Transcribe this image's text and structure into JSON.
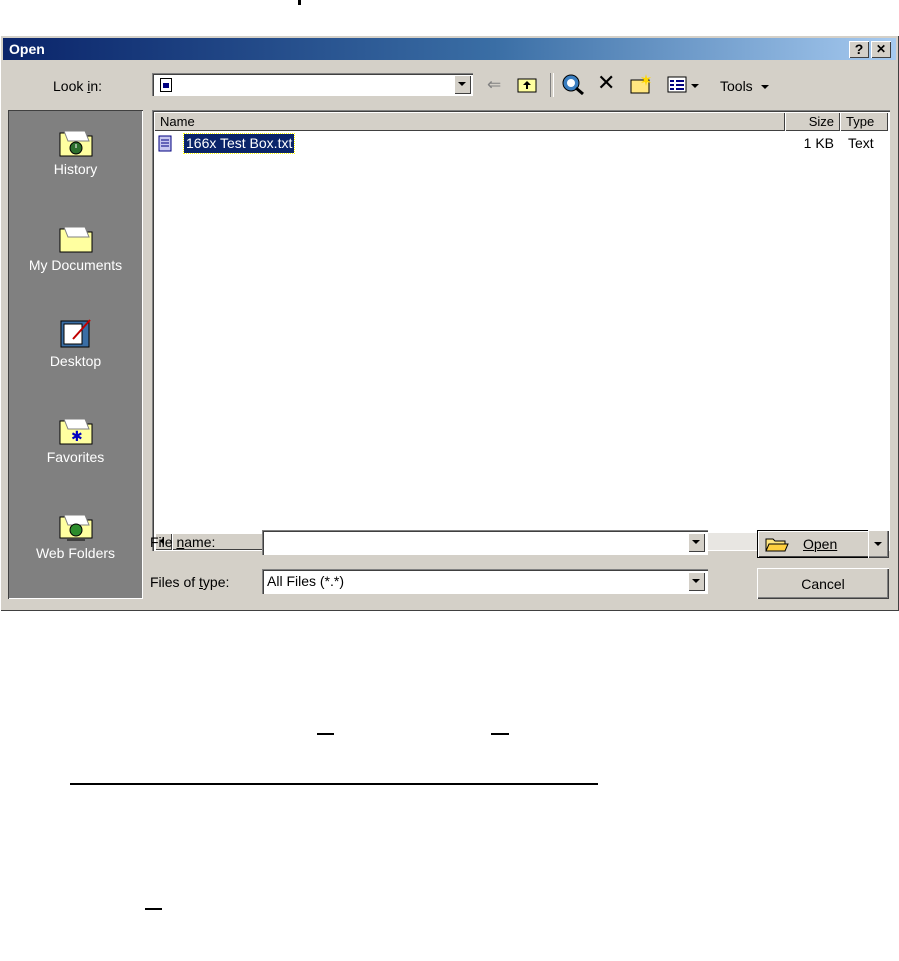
{
  "dialog": {
    "title": "Open",
    "help_button": "?",
    "close_button": "✕"
  },
  "toolbar": {
    "look_in_label": "Look in:",
    "look_in_value": "",
    "tools_label": "Tools",
    "icons": [
      "back-icon",
      "up-folder-icon",
      "search-web-icon",
      "delete-icon",
      "new-folder-icon",
      "views-icon"
    ]
  },
  "places": [
    {
      "label": "History",
      "icon": "history-folder-icon"
    },
    {
      "label": "My Documents",
      "icon": "my-documents-folder-icon"
    },
    {
      "label": "Desktop",
      "icon": "desktop-icon"
    },
    {
      "label": "Favorites",
      "icon": "favorites-folder-icon"
    },
    {
      "label": "Web Folders",
      "icon": "web-folders-icon"
    }
  ],
  "file_list": {
    "columns": [
      "Name",
      "Size",
      "Type"
    ],
    "rows": [
      {
        "name": "166x Test Box.txt",
        "size": "1 KB",
        "type": "Text",
        "selected": true
      }
    ]
  },
  "form": {
    "file_name_label": "File name:",
    "file_name_value": "",
    "files_of_type_label": "Files of type:",
    "files_of_type_value": "All Files (*.*)"
  },
  "buttons": {
    "open": "Open",
    "cancel": "Cancel"
  },
  "colors": {
    "title_start": "#0a246a",
    "title_end": "#a6caf0",
    "face": "#d4d0c8",
    "places_bg": "#808080",
    "selection": "#0a246a"
  }
}
